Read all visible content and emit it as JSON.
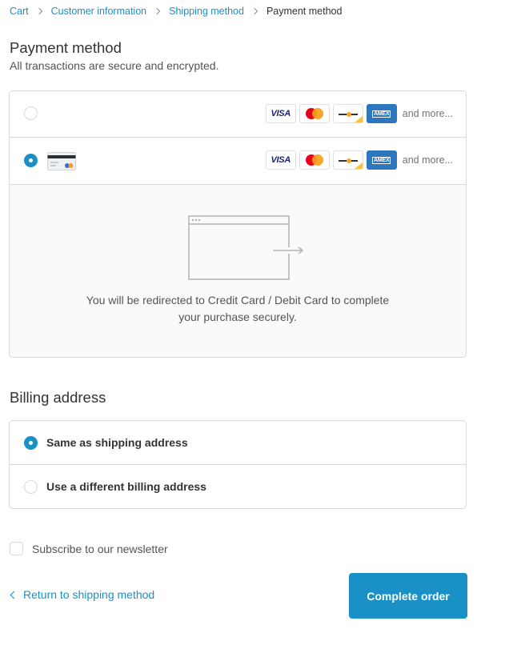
{
  "breadcrumb": {
    "items": [
      {
        "label": "Cart"
      },
      {
        "label": "Customer information"
      },
      {
        "label": "Shipping method"
      }
    ],
    "current": "Payment method"
  },
  "payment": {
    "title": "Payment method",
    "subtitle": "All transactions are secure and encrypted.",
    "card_brands": [
      {
        "icon": "visa-icon",
        "label": "VISA"
      },
      {
        "icon": "mastercard-icon"
      },
      {
        "icon": "card-brand-icon"
      },
      {
        "icon": "amex-icon",
        "label": "AMEX"
      }
    ],
    "and_more": "and more...",
    "options": [
      {
        "selected": false
      },
      {
        "selected": true,
        "icon": "credit-card-icon"
      }
    ],
    "redirect_text_line1": "You will be redirected to Credit Card / Debit Card to complete",
    "redirect_text_line2": "your purchase securely."
  },
  "billing": {
    "title": "Billing address",
    "options": [
      {
        "label": "Same as shipping address",
        "selected": true
      },
      {
        "label": "Use a different billing address",
        "selected": false
      }
    ]
  },
  "newsletter": {
    "label": "Subscribe to our newsletter",
    "checked": false
  },
  "footer": {
    "return_label": "Return to shipping method",
    "complete_label": "Complete order"
  },
  "colors": {
    "accent": "#1990c6",
    "border": "#d9d9d9",
    "text": "#333333",
    "muted": "#545454"
  }
}
